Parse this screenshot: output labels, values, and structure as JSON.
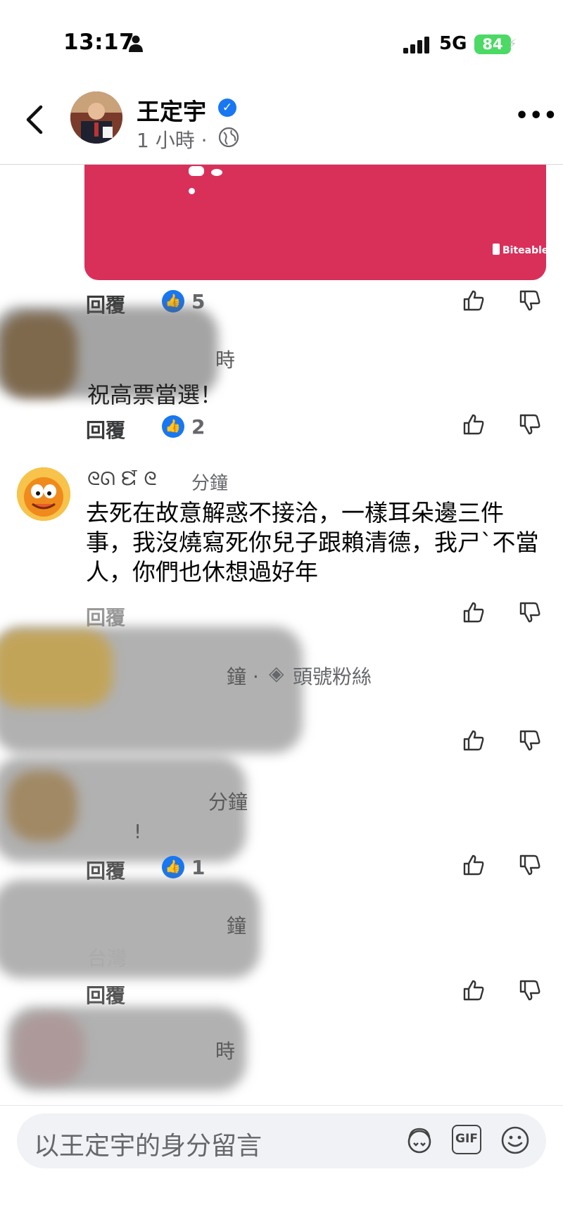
{
  "status_bar": {
    "time": "13:17",
    "network": "5G",
    "battery": "84"
  },
  "header": {
    "author": "王定宇",
    "post_time": "1 小時 ·"
  },
  "card": {
    "brand": "Biteable"
  },
  "actions": {
    "reply": "回覆"
  },
  "comments": [
    {
      "time": "",
      "text": "",
      "like_count": "5",
      "ghost_time": ""
    },
    {
      "time": "時",
      "text": "祝高票當選！",
      "like_count": "2"
    },
    {
      "name": "ᘓᘏ ᘿ ᘓ",
      "time": "分鐘",
      "text": "去死在故意解惑不接洽，一樣耳朵邊三件事，我沒燒寫死你兒子跟賴清德，我ㄕˋ不當人，你們也休想過好年",
      "like_count": ""
    },
    {
      "time": "鐘 ·",
      "badge": "頭號粉絲",
      "text": "",
      "like_count": ""
    },
    {
      "time": "分鐘",
      "text": "!",
      "like_count": "1"
    },
    {
      "time": "鐘",
      "text": "台灣",
      "like_count": ""
    },
    {
      "time": "時",
      "text": "",
      "like_count": ""
    }
  ],
  "composer": {
    "placeholder": "以王定宇的身分留言",
    "gif_label": "GIF"
  },
  "colors": {
    "accent": "#1877f2",
    "card": "#d9305a",
    "battery": "#4cd964"
  }
}
